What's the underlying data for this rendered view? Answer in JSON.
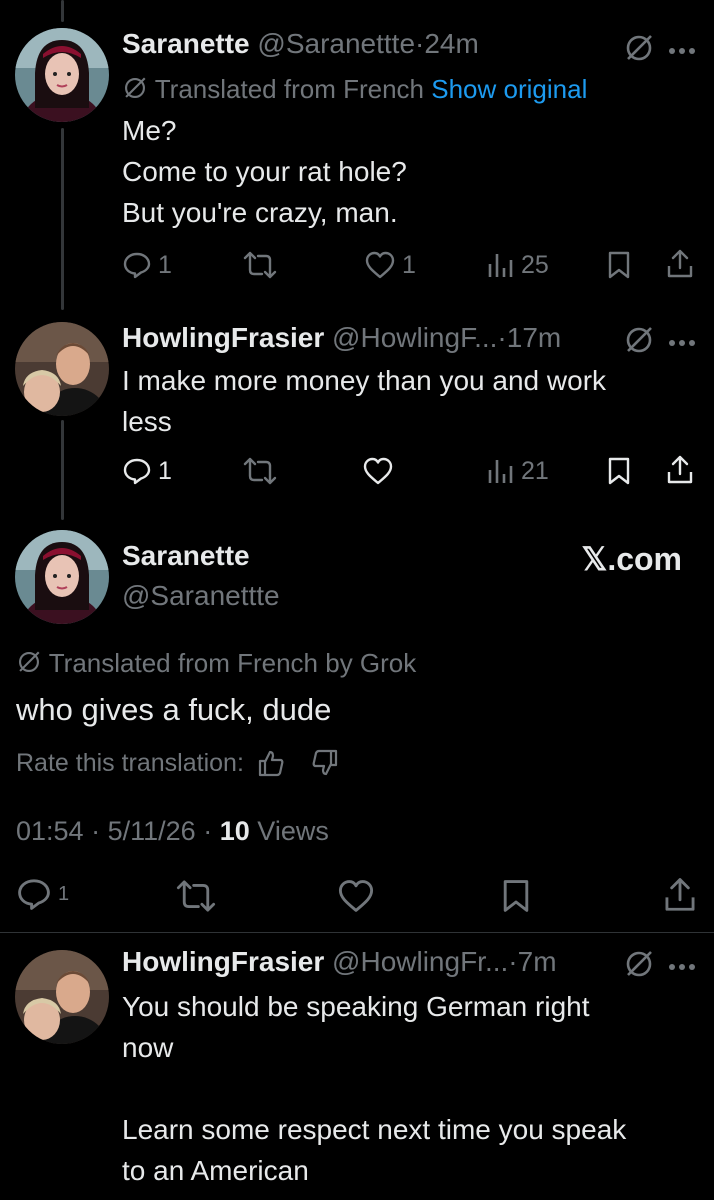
{
  "tweets": [
    {
      "name": "Saranette",
      "handle": "@Saranettte",
      "dot": "·",
      "time": "24m",
      "translated_label": "Translated from French",
      "show_original": "Show original",
      "lines": [
        "Me?",
        "Come to your rat hole?",
        "But you're crazy, man."
      ],
      "replies": "1",
      "retweets": "",
      "likes": "1",
      "views": "25"
    },
    {
      "name": "HowlingFrasier",
      "handle": "@HowlingF...",
      "dot": "·",
      "time": "17m",
      "lines": [
        "I make more money than you and work",
        "less"
      ],
      "replies": "1",
      "retweets": "",
      "likes": "",
      "views": "21"
    }
  ],
  "focus": {
    "name": "Saranette",
    "handle": "@Saranettte",
    "watermark": "𝕏.com",
    "translated_label": "Translated from French by Grok",
    "text": "who gives a fuck, dude",
    "rate_label": "Rate this translation:",
    "time": "01:54",
    "dot1": "·",
    "date": "5/11/26",
    "dot2": "·",
    "views_count": "10",
    "views_label": "Views",
    "replies": "1"
  },
  "reply": {
    "name": "HowlingFrasier",
    "handle": "@HowlingFr...",
    "dot": "·",
    "time": "7m",
    "lines": [
      "You should be speaking German right",
      "now",
      "",
      "Learn some respect next time you speak",
      "to an American"
    ]
  },
  "colors": {
    "background": "#000000",
    "text": "#e7e9ea",
    "muted": "#71767b",
    "link": "#1d9bf0"
  }
}
